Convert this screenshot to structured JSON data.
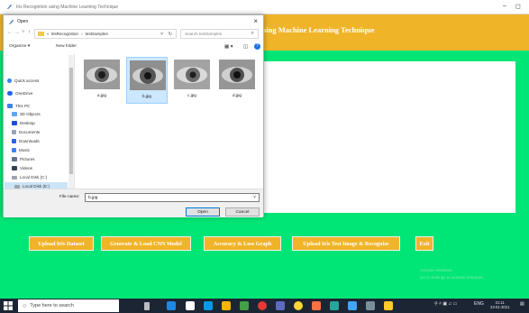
{
  "app": {
    "title": "Iris Recognition using Machine Learning Technique",
    "heading": "sing Machine Learning Technique"
  },
  "buttons": {
    "upload_dataset": "Upload Iris Dataset",
    "generate_cnn": "Generate & Load CNN Model",
    "accuracy_graph": "Accuracy & Loss Graph",
    "upload_test": "Upload Iris Test Image & Recognize",
    "exit": "Exit"
  },
  "watermark": {
    "line1": "Activate Windows",
    "line2": "Go to Settings to activate Windows."
  },
  "dialog": {
    "title": "Open",
    "breadcrumb": [
      "IrisRecognition",
      "testSamples"
    ],
    "search_placeholder": "Search testSamples",
    "organize": "Organize ▾",
    "new_folder": "New folder",
    "nav_items": [
      {
        "label": "Quick access"
      },
      {
        "label": "OneDrive"
      },
      {
        "label": "This PC"
      },
      {
        "label": "3D Objects"
      },
      {
        "label": "Desktop"
      },
      {
        "label": "Documents"
      },
      {
        "label": "Downloads"
      },
      {
        "label": "Music"
      },
      {
        "label": "Pictures"
      },
      {
        "label": "Videos"
      },
      {
        "label": "Local Disk (C:)"
      },
      {
        "label": "Local Disk (E:)"
      }
    ],
    "files": [
      {
        "name": "a.jpg"
      },
      {
        "name": "b.jpg"
      },
      {
        "name": "c.jpg"
      },
      {
        "name": "d.jpg"
      }
    ],
    "selected_file": "b.jpg",
    "file_name_label": "File name:",
    "file_name_value": "b.jpg",
    "open_label": "Open",
    "cancel_label": "Cancel"
  },
  "taskbar": {
    "search_placeholder": "Type here to search",
    "time": "21:11",
    "date": "23-01-2021",
    "lang": "ENG"
  },
  "colors": {
    "background": "#00e676",
    "accent": "#f0b429"
  }
}
